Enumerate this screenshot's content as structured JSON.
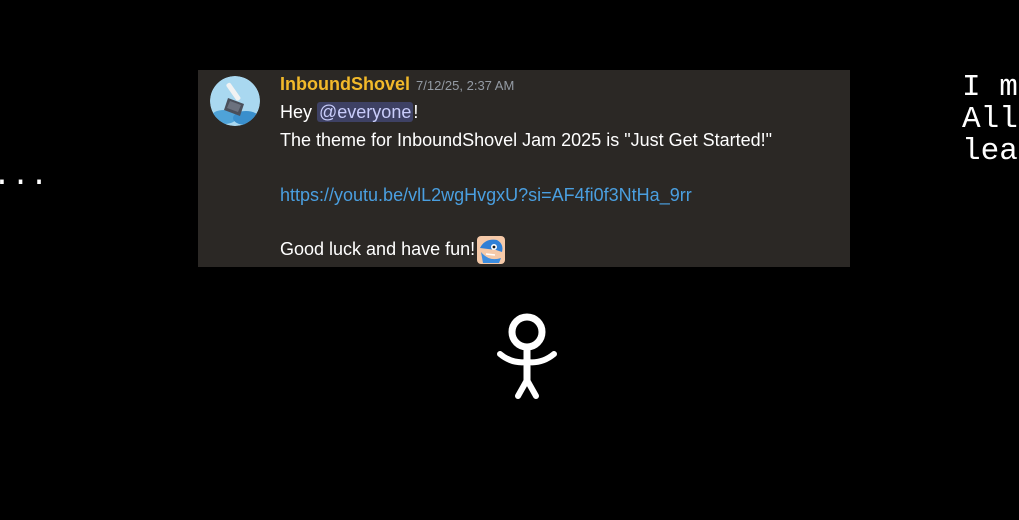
{
  "scene": {
    "left_text": "y...",
    "right_text": "I m\nAll\nlea"
  },
  "message": {
    "username": "InboundShovel",
    "timestamp": "7/12/25, 2:37 AM",
    "line1_prefix": "Hey ",
    "mention": "@everyone",
    "line1_suffix": "!",
    "line2": "The theme for InboundShovel Jam 2025 is \"Just Get Started!\"",
    "link": "https://youtu.be/vlL2wgHvgxU?si=AF4fi0f3NtHa_9rr",
    "line4": "Good luck and have fun!",
    "avatar_icon": "shovel-avatar-icon",
    "emoji_icon": "blue-character-emoji-icon"
  },
  "colors": {
    "background": "#000000",
    "card": "#2b2825",
    "username": "#f2b92a",
    "link": "#4a9fe0",
    "mention_bg": "#3e4164"
  }
}
